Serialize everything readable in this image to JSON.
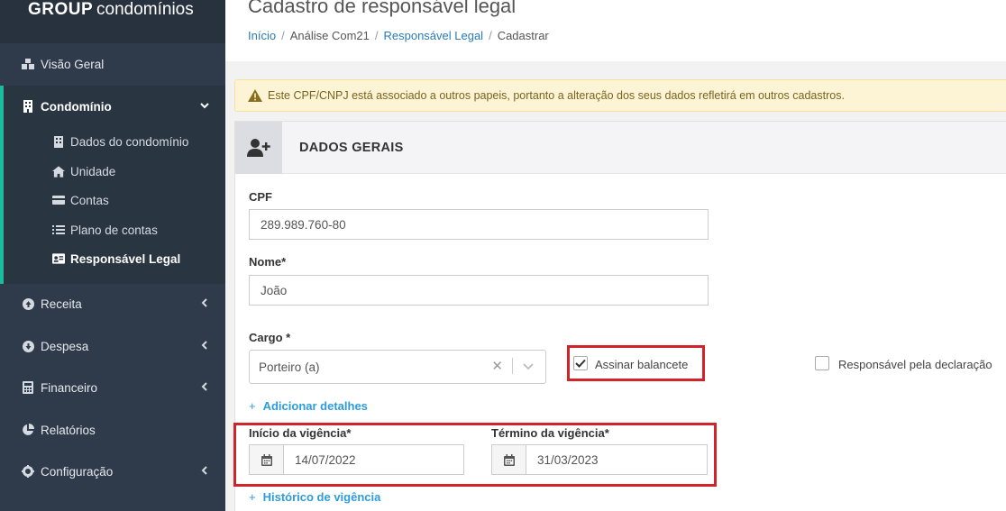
{
  "sidebar": {
    "brand_bold": "GROUP",
    "brand_light": "condomínios",
    "items": {
      "overview": "Visão Geral",
      "condominio": "Condomínio",
      "receita": "Receita",
      "despesa": "Despesa",
      "financeiro": "Financeiro",
      "relatorios": "Relatórios",
      "configuracao": "Configuração"
    },
    "sub_items": {
      "dados": "Dados do condomínio",
      "unidade": "Unidade",
      "contas": "Contas",
      "plano": "Plano de contas",
      "responsavel": "Responsável Legal"
    }
  },
  "header": {
    "title": "Cadastro de responsável legal",
    "breadcrumb": {
      "inicio": "Início",
      "analise": "Análise Com21",
      "responsavel": "Responsável Legal",
      "cadastrar": "Cadastrar",
      "sep": "/"
    }
  },
  "alert": {
    "text": "Este CPF/CNPJ está associado a outros papeis, portanto a alteração dos seus dados refletirá em outros cadastros."
  },
  "form": {
    "section_title": "DADOS GERAIS",
    "cpf_label": "CPF",
    "cpf_value": "289.989.760-80",
    "nome_label": "Nome*",
    "nome_value": "João",
    "cargo_label": "Cargo *",
    "cargo_value": "Porteiro (a)",
    "assinar_label": "Assinar balancete",
    "assinar_checked": true,
    "responsavel_decl_label": "Responsável pela declaração",
    "responsavel_decl_checked": false,
    "add_detalhes": "Adicionar detalhes",
    "inicio_label": "Início da vigência*",
    "inicio_value": "14/07/2022",
    "termino_label": "Término da vigência*",
    "termino_value": "31/03/2023",
    "historico": "Histórico de vigência"
  },
  "colors": {
    "sidebar_bg": "#2f3b4a",
    "accent": "#1abc9c",
    "link": "#2d9cdb",
    "highlight": "#d2232a"
  }
}
